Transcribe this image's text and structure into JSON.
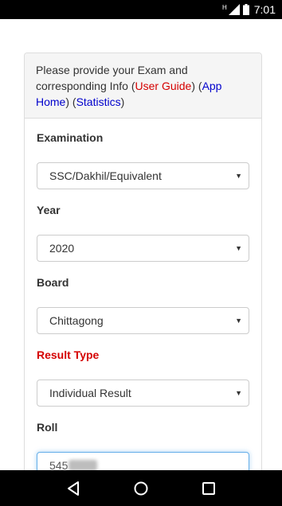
{
  "status_bar": {
    "network": "H",
    "time": "7:01"
  },
  "panel": {
    "heading_pre": "Please provide your Exam and corresponding Info (",
    "user_guide": "User Guide",
    "heading_mid1": ") (",
    "app_home": "App Home",
    "heading_mid2": ") (",
    "statistics": "Statistics",
    "heading_end": ")"
  },
  "form": {
    "examination": {
      "label": "Examination",
      "value": "SSC/Dakhil/Equivalent"
    },
    "year": {
      "label": "Year",
      "value": "2020"
    },
    "board": {
      "label": "Board",
      "value": "Chittagong"
    },
    "result_type": {
      "label": "Result Type",
      "value": "Individual Result"
    },
    "roll": {
      "label": "Roll",
      "value": "545"
    }
  },
  "colors": {
    "accent_red": "#d50000",
    "link_blue": "#0000cc",
    "focus_border": "#66afe9"
  },
  "nav_bar": {
    "back_icon": "back-triangle-icon",
    "home_icon": "home-circle-icon",
    "recents_icon": "recents-square-icon"
  }
}
